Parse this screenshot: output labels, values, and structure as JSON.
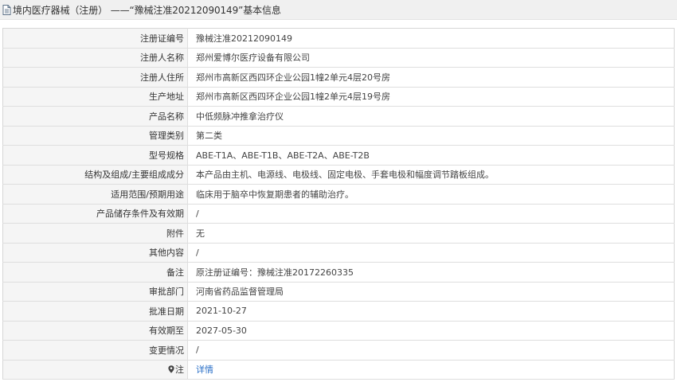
{
  "header": {
    "title": "境内医疗器械（注册） ——“豫械注准20212090149”基本信息"
  },
  "rows": [
    {
      "label": "注册证编号",
      "value": "豫械注准20212090149"
    },
    {
      "label": "注册人名称",
      "value": "郑州爱博尔医疗设备有限公司"
    },
    {
      "label": "注册人住所",
      "value": "郑州市高新区西四环企业公园1幢2单元4层20号房"
    },
    {
      "label": "生产地址",
      "value": "郑州市高新区西四环企业公园1幢2单元4层19号房"
    },
    {
      "label": "产品名称",
      "value": "中低频脉冲推拿治疗仪"
    },
    {
      "label": "管理类别",
      "value": "第二类"
    },
    {
      "label": "型号规格",
      "value": "ABE-T1A、ABE-T1B、ABE-T2A、ABE-T2B"
    },
    {
      "label": "结构及组成/主要组成成分",
      "value": "本产品由主机、电源线、电极线、固定电极、手套电极和幅度调节踏板组成。"
    },
    {
      "label": "适用范围/预期用途",
      "value": "临床用于脑卒中恢复期患者的辅助治疗。"
    },
    {
      "label": "产品储存条件及有效期",
      "value": "/"
    },
    {
      "label": "附件",
      "value": "无"
    },
    {
      "label": "其他内容",
      "value": "/"
    },
    {
      "label": "备注",
      "value": "原注册证编号：豫械注准20172260335"
    },
    {
      "label": "审批部门",
      "value": "河南省药品监督管理局"
    },
    {
      "label": "批准日期",
      "value": "2021-10-27"
    },
    {
      "label": "有效期至",
      "value": "2027-05-30"
    },
    {
      "label": "变更情况",
      "value": "/"
    }
  ],
  "note_row": {
    "label": "注",
    "link": "详情"
  },
  "icons": {
    "title_icon": "document-icon",
    "note_icon": "map-pin-icon"
  }
}
